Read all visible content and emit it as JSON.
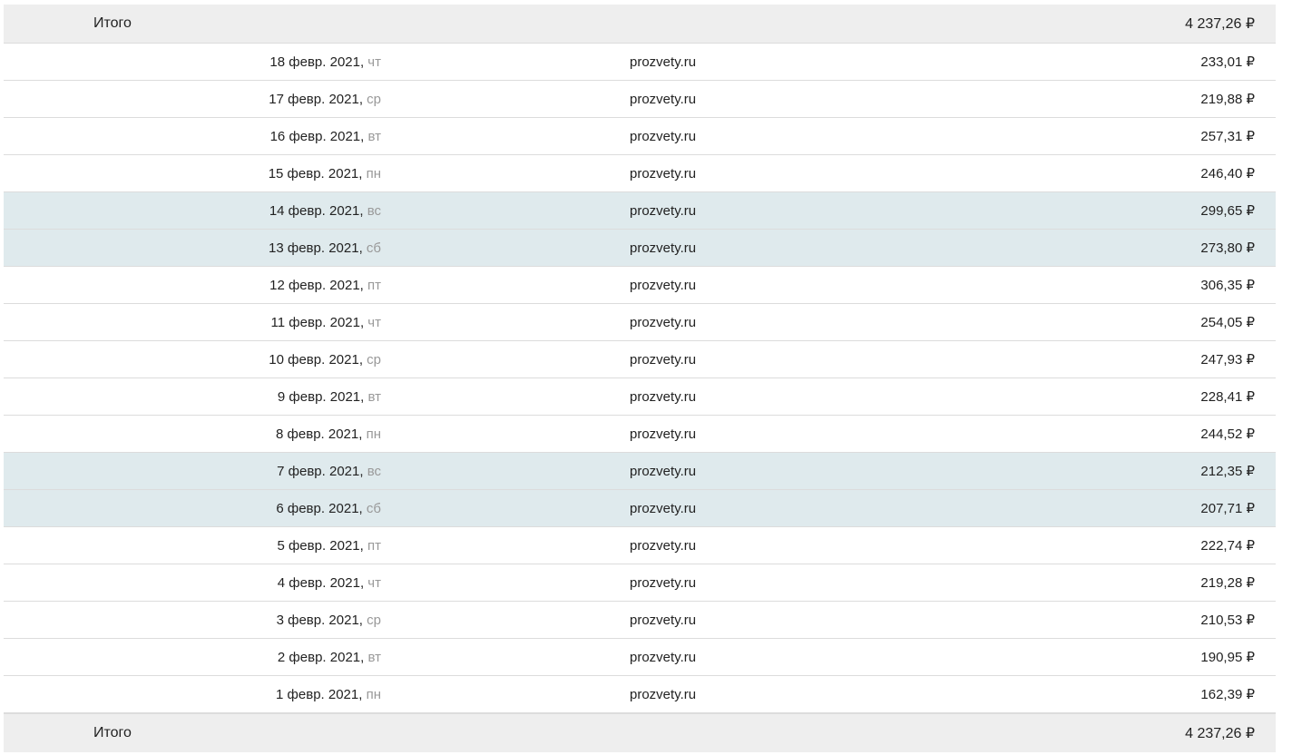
{
  "totals": {
    "label": "Итого",
    "value": "4 237,26 ₽"
  },
  "rows": [
    {
      "date": "18 февр. 2021,",
      "weekday": " чт",
      "site": "prozvety.ru",
      "amount": "233,01 ₽",
      "weekend": false
    },
    {
      "date": "17 февр. 2021,",
      "weekday": " ср",
      "site": "prozvety.ru",
      "amount": "219,88 ₽",
      "weekend": false
    },
    {
      "date": "16 февр. 2021,",
      "weekday": " вт",
      "site": "prozvety.ru",
      "amount": "257,31 ₽",
      "weekend": false
    },
    {
      "date": "15 февр. 2021,",
      "weekday": " пн",
      "site": "prozvety.ru",
      "amount": "246,40 ₽",
      "weekend": false
    },
    {
      "date": "14 февр. 2021,",
      "weekday": " вс",
      "site": "prozvety.ru",
      "amount": "299,65 ₽",
      "weekend": true
    },
    {
      "date": "13 февр. 2021,",
      "weekday": " сб",
      "site": "prozvety.ru",
      "amount": "273,80 ₽",
      "weekend": true
    },
    {
      "date": "12 февр. 2021,",
      "weekday": " пт",
      "site": "prozvety.ru",
      "amount": "306,35 ₽",
      "weekend": false
    },
    {
      "date": "11 февр. 2021,",
      "weekday": " чт",
      "site": "prozvety.ru",
      "amount": "254,05 ₽",
      "weekend": false
    },
    {
      "date": "10 февр. 2021,",
      "weekday": " ср",
      "site": "prozvety.ru",
      "amount": "247,93 ₽",
      "weekend": false
    },
    {
      "date": "9 февр. 2021,",
      "weekday": " вт",
      "site": "prozvety.ru",
      "amount": "228,41 ₽",
      "weekend": false
    },
    {
      "date": "8 февр. 2021,",
      "weekday": " пн",
      "site": "prozvety.ru",
      "amount": "244,52 ₽",
      "weekend": false
    },
    {
      "date": "7 февр. 2021,",
      "weekday": " вс",
      "site": "prozvety.ru",
      "amount": "212,35 ₽",
      "weekend": true
    },
    {
      "date": "6 февр. 2021,",
      "weekday": " сб",
      "site": "prozvety.ru",
      "amount": "207,71 ₽",
      "weekend": true
    },
    {
      "date": "5 февр. 2021,",
      "weekday": " пт",
      "site": "prozvety.ru",
      "amount": "222,74 ₽",
      "weekend": false
    },
    {
      "date": "4 февр. 2021,",
      "weekday": " чт",
      "site": "prozvety.ru",
      "amount": "219,28 ₽",
      "weekend": false
    },
    {
      "date": "3 февр. 2021,",
      "weekday": " ср",
      "site": "prozvety.ru",
      "amount": "210,53 ₽",
      "weekend": false
    },
    {
      "date": "2 февр. 2021,",
      "weekday": " вт",
      "site": "prozvety.ru",
      "amount": "190,95 ₽",
      "weekend": false
    },
    {
      "date": "1 февр. 2021,",
      "weekday": " пн",
      "site": "prozvety.ru",
      "amount": "162,39 ₽",
      "weekend": false
    }
  ],
  "colors": {
    "total_bg": "#eeeeee",
    "weekend_bg": "#dfeaed",
    "weekday_text": "#999999",
    "border": "#dcdcdc"
  }
}
